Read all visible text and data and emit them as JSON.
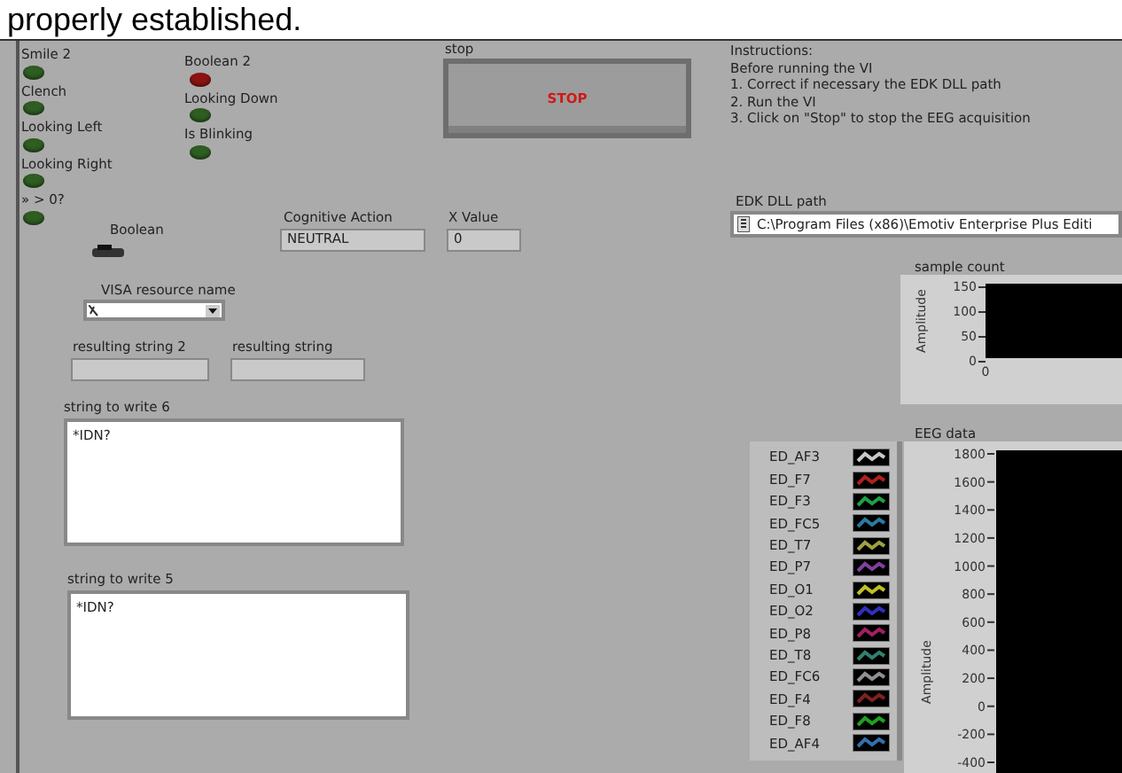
{
  "header_text": "properly established.",
  "front_panel": {
    "led_columns": [
      [
        {
          "label": "Smile 2",
          "color": "#2f5e22"
        },
        {
          "label": "Clench",
          "color": "#2f5e22"
        },
        {
          "label": "Looking Left",
          "color": "#2f5e22"
        },
        {
          "label": "Looking Right",
          "color": "#2f5e22"
        },
        {
          "label": "» > 0?",
          "color": "#2f5e22"
        }
      ],
      [
        {
          "label": "Boolean 2",
          "color": "#8e1414"
        },
        {
          "label": "Looking Down",
          "color": "#2f5e22"
        },
        {
          "label": "Is Blinking",
          "color": "#2f5e22"
        }
      ]
    ],
    "stop_button": {
      "label": "stop",
      "text": "STOP"
    },
    "instructions": [
      "Instructions:",
      "Before running the VI",
      "1. Correct if necessary the EDK DLL path",
      "2. Run the VI",
      "3. Click on \"Stop\" to stop the EEG acquisition"
    ],
    "edk_dll_path": {
      "label": "EDK DLL path",
      "value": "C:\\Program Files (x86)\\Emotiv Enterprise Plus Editi"
    },
    "boolean_switch": {
      "label": "Boolean",
      "on": false
    },
    "cognitive_action": {
      "label": "Cognitive Action",
      "value": "NEUTRAL"
    },
    "x_value": {
      "label": "X Value",
      "value": "0"
    },
    "visa_resource_name": {
      "label": "VISA resource name"
    },
    "resulting_strings": [
      {
        "label": "resulting string 2"
      },
      {
        "label": "resulting string"
      }
    ],
    "strings_to_write": [
      {
        "label": "string to write 6",
        "value": "*IDN?"
      },
      {
        "label": "string to write 5",
        "value": "*IDN?"
      }
    ],
    "sample_count_chart": {
      "title": "sample count",
      "y_axis_title": "Amplitude",
      "y_axis_labels": [
        "150",
        "100",
        "50",
        "0"
      ],
      "x_axis_labels": [
        "0"
      ]
    },
    "eeg_data_chart": {
      "title": "EEG data",
      "y_axis_title": "Amplitude",
      "y_axis_labels": [
        "1800",
        "1600",
        "1400",
        "1200",
        "1000",
        "800",
        "600",
        "400",
        "200",
        "0",
        "-200",
        "-400"
      ],
      "legend": [
        {
          "name": "ED_AF3",
          "color": "#c8c8c8"
        },
        {
          "name": "ED_F7",
          "color": "#b02020"
        },
        {
          "name": "ED_F3",
          "color": "#20a040"
        },
        {
          "name": "ED_FC5",
          "color": "#2a7aa0"
        },
        {
          "name": "ED_T7",
          "color": "#a0a040"
        },
        {
          "name": "ED_P7",
          "color": "#8040a0"
        },
        {
          "name": "ED_O1",
          "color": "#c0c020"
        },
        {
          "name": "ED_O2",
          "color": "#3030c0"
        },
        {
          "name": "ED_P8",
          "color": "#a02060"
        },
        {
          "name": "ED_T8",
          "color": "#308070"
        },
        {
          "name": "ED_FC6",
          "color": "#909090"
        },
        {
          "name": "ED_F4",
          "color": "#802020"
        },
        {
          "name": "ED_F8",
          "color": "#20a020"
        },
        {
          "name": "ED_AF4",
          "color": "#3070b0"
        }
      ]
    }
  }
}
